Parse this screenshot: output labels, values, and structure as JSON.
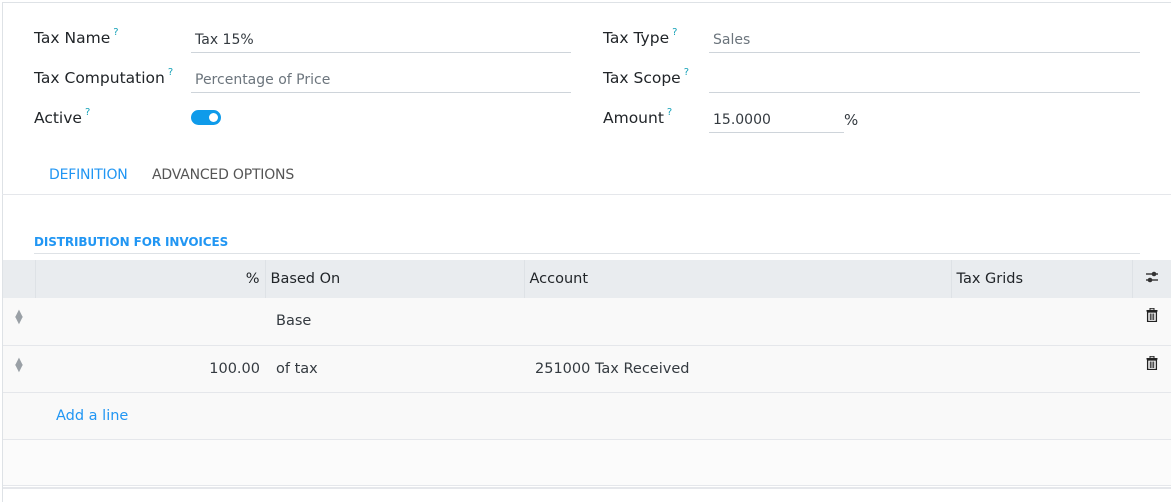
{
  "form": {
    "left": [
      {
        "label": "Tax Name",
        "help": "?",
        "value": "Tax 15%",
        "is_placeholder": false
      },
      {
        "label": "Tax Computation",
        "help": "?",
        "value": "Percentage of Price",
        "is_placeholder": true
      },
      {
        "label": "Active",
        "help": "?",
        "toggle_on": true
      }
    ],
    "right": [
      {
        "label": "Tax Type",
        "help": "?",
        "value": "Sales",
        "is_placeholder": true
      },
      {
        "label": "Tax Scope",
        "help": "?",
        "value": ""
      },
      {
        "label": "Amount",
        "help": "?",
        "value": "15.0000",
        "suffix": "%"
      }
    ]
  },
  "tabs": [
    {
      "label": "DEFINITION",
      "active": true
    },
    {
      "label": "ADVANCED OPTIONS",
      "active": false
    }
  ],
  "section": {
    "title": "DISTRIBUTION FOR INVOICES"
  },
  "table": {
    "columns": [
      "%",
      "Based On",
      "Account",
      "Tax Grids"
    ],
    "rows": [
      {
        "percent": "",
        "based_on": "Base",
        "account": "",
        "tax_grids": ""
      },
      {
        "percent": "100.00",
        "based_on": "of tax",
        "account": "251000 Tax Received",
        "tax_grids": ""
      }
    ],
    "add_line": "Add a line"
  },
  "colors": {
    "accent": "#2196f3",
    "toggle": "#0f9bea",
    "header_bg": "#e9ecef"
  }
}
